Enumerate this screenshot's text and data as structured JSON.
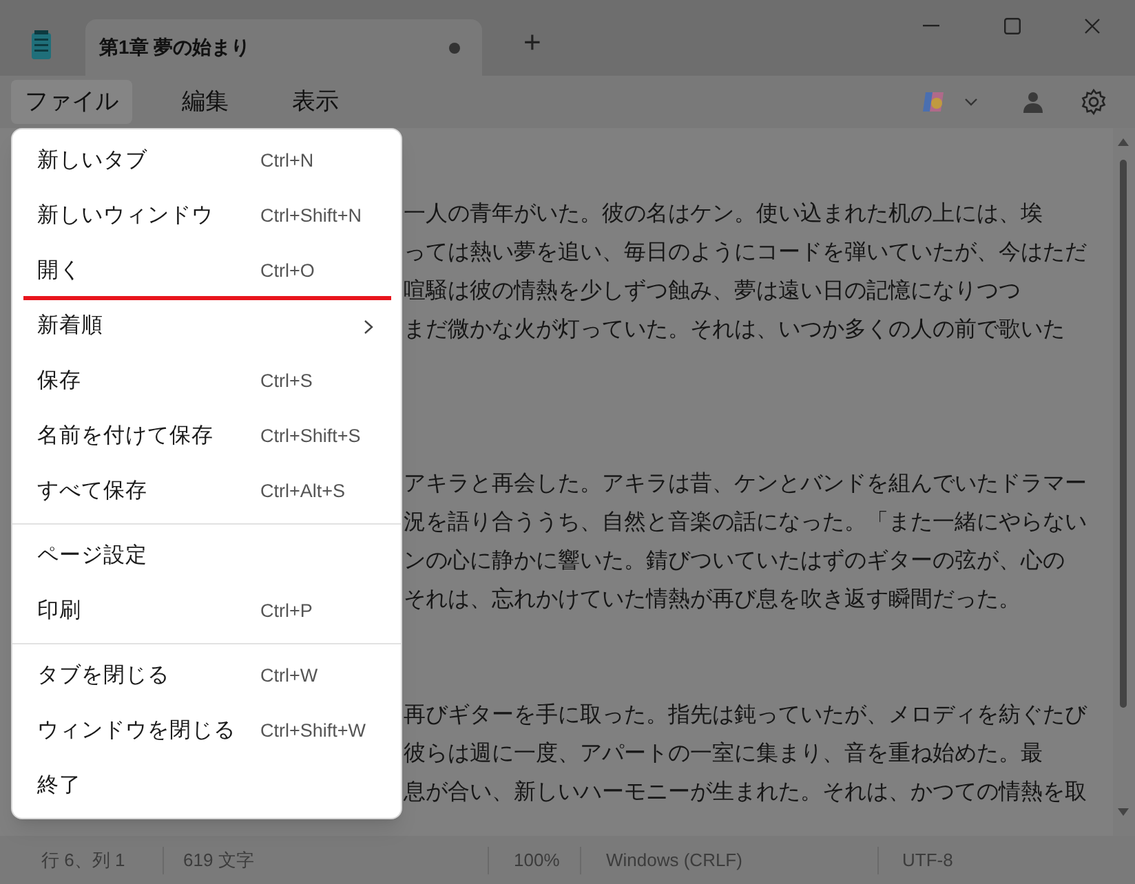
{
  "window": {
    "tab_title": "第1章 夢の始まり",
    "unsaved": true,
    "new_tab_button": "+"
  },
  "menubar": [
    {
      "label": "ファイル",
      "selected": true
    },
    {
      "label": "編集",
      "selected": false
    },
    {
      "label": "表示",
      "selected": false
    }
  ],
  "editor": {
    "paragraphs": [
      {
        "lines": [
          "一人の青年がいた。彼の名はケン。使い込まれた机の上には、埃",
          "っては熱い夢を追い、毎日のようにコードを弾いていたが、今はただ",
          "喧騒は彼の情熱を少しずつ蝕み、夢は遠い日の記憶になりつつ",
          "まだ微かな火が灯っていた。それは、いつか多くの人の前で歌いた"
        ]
      },
      {
        "lines": [
          "アキラと再会した。アキラは昔、ケンとバンドを組んでいたドラマー",
          "況を語り合ううち、自然と音楽の話になった。「また一緒にやらない",
          "ンの心に静かに響いた。錆びついていたはずのギターの弦が、心の",
          "それは、忘れかけていた情熱が再び息を吹き返す瞬間だった。"
        ]
      },
      {
        "lines": [
          "再びギターを手に取った。指先は鈍っていたが、メロディを紡ぐたび",
          "彼らは週に一度、アパートの一室に集まり、音を重ね始めた。最",
          "息が合い、新しいハーモニーが生まれた。それは、かつての情熱を取"
        ]
      }
    ]
  },
  "file_menu": {
    "groups": [
      [
        {
          "kind": "item",
          "label": "新しいタブ",
          "shortcut": "Ctrl+N",
          "underlined": false
        },
        {
          "kind": "item",
          "label": "新しいウィンドウ",
          "shortcut": "Ctrl+Shift+N",
          "underlined": false
        },
        {
          "kind": "item",
          "label": "開く",
          "shortcut": "Ctrl+O",
          "underlined": true
        },
        {
          "kind": "submenu",
          "label": "新着順",
          "underlined": false
        },
        {
          "kind": "item",
          "label": "保存",
          "shortcut": "Ctrl+S",
          "underlined": false
        },
        {
          "kind": "item",
          "label": "名前を付けて保存",
          "shortcut": "Ctrl+Shift+S",
          "underlined": false
        },
        {
          "kind": "item",
          "label": "すべて保存",
          "shortcut": "Ctrl+Alt+S",
          "underlined": false
        }
      ],
      [
        {
          "kind": "item",
          "label": "ページ設定",
          "underlined": false
        },
        {
          "kind": "item",
          "label": "印刷",
          "shortcut": "Ctrl+P",
          "underlined": false
        }
      ],
      [
        {
          "kind": "item",
          "label": "タブを閉じる",
          "shortcut": "Ctrl+W",
          "underlined": false
        },
        {
          "kind": "item",
          "label": "ウィンドウを閉じる",
          "shortcut": "Ctrl+Shift+W",
          "underlined": false
        },
        {
          "kind": "item",
          "label": "終了",
          "underlined": false
        }
      ]
    ]
  },
  "status_bar": {
    "position": "行 6、列 1",
    "chars": "619 文字",
    "zoom": "100%",
    "line_ending": "Windows (CRLF)",
    "encoding": "UTF-8"
  }
}
